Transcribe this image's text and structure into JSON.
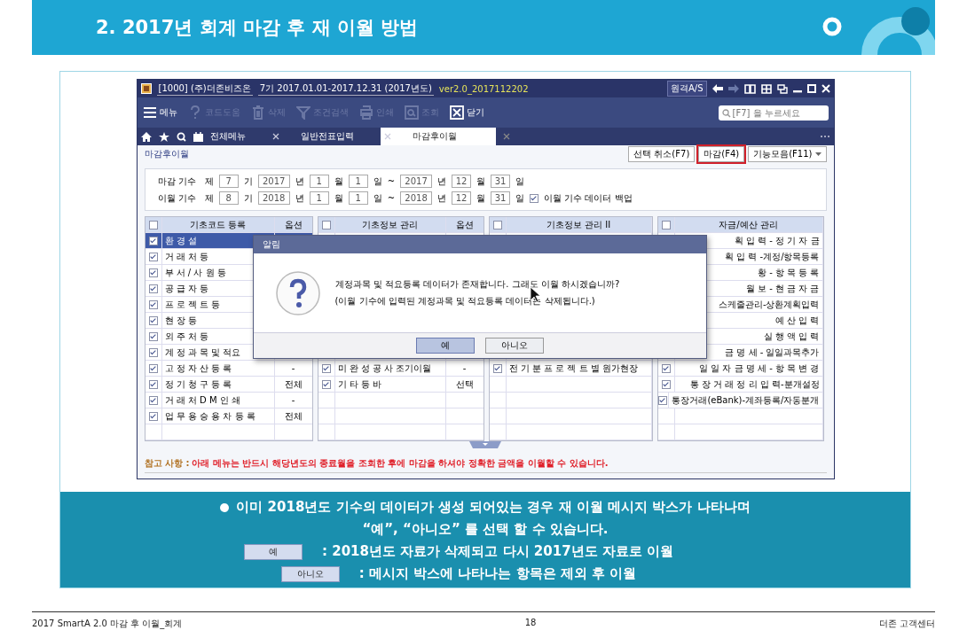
{
  "slide": {
    "title": "2. 2017년 회계 마감 후 재 이월 방법"
  },
  "app": {
    "title_segments": [
      "[1000] (주)더존비즈온",
      "7기 2017.01.01-2017.12.31 (2017년도)"
    ],
    "version": "ver2.0_2017112202",
    "remote_label": "원격A/S",
    "toolbar": [
      {
        "label": "메뉴",
        "disabled": false
      },
      {
        "label": "코드도움",
        "disabled": true
      },
      {
        "label": "삭제",
        "disabled": true
      },
      {
        "label": "조건검색",
        "disabled": true
      },
      {
        "label": "인쇄",
        "disabled": true
      },
      {
        "label": "조회",
        "disabled": true
      },
      {
        "label": "닫기",
        "disabled": false
      }
    ],
    "search": {
      "placeholder": "[F7] 을 누르세요"
    },
    "tabs": [
      {
        "label": "전체메뉴",
        "selected": false
      },
      {
        "label": "일반전표입력",
        "selected": false
      },
      {
        "label": "마감후이월",
        "selected": true
      }
    ],
    "page_title": "마감후이월",
    "actions": [
      {
        "label": "선택 취소(F7)",
        "highlighted": false
      },
      {
        "label": "마감(F4)",
        "highlighted": true
      },
      {
        "label": "기능모음(F11)",
        "highlighted": false
      }
    ],
    "periods": [
      {
        "label": "마감 기수",
        "parts": [
          {
            "kind": "text",
            "value": "제"
          },
          {
            "kind": "field",
            "value": "7"
          },
          {
            "kind": "text",
            "value": "기"
          },
          {
            "kind": "field",
            "value": "2017"
          },
          {
            "kind": "text",
            "value": "년"
          },
          {
            "kind": "field",
            "value": "1"
          },
          {
            "kind": "text",
            "value": "월"
          },
          {
            "kind": "field",
            "value": "1"
          },
          {
            "kind": "text",
            "value": "일"
          },
          {
            "kind": "text",
            "value": "~"
          },
          {
            "kind": "field",
            "value": "2017"
          },
          {
            "kind": "text",
            "value": "년"
          },
          {
            "kind": "field",
            "value": "12"
          },
          {
            "kind": "text",
            "value": "월"
          },
          {
            "kind": "field",
            "value": "31"
          },
          {
            "kind": "text",
            "value": "일"
          }
        ]
      },
      {
        "label": "이월 기수",
        "parts": [
          {
            "kind": "text",
            "value": "제"
          },
          {
            "kind": "field",
            "value": "8"
          },
          {
            "kind": "text",
            "value": "기"
          },
          {
            "kind": "field",
            "value": "2018"
          },
          {
            "kind": "text",
            "value": "년"
          },
          {
            "kind": "field",
            "value": "1"
          },
          {
            "kind": "text",
            "value": "월"
          },
          {
            "kind": "field",
            "value": "1"
          },
          {
            "kind": "text",
            "value": "일"
          },
          {
            "kind": "text",
            "value": "~"
          },
          {
            "kind": "field",
            "value": "2018"
          },
          {
            "kind": "text",
            "value": "년"
          },
          {
            "kind": "field",
            "value": "12"
          },
          {
            "kind": "text",
            "value": "월"
          },
          {
            "kind": "field",
            "value": "31"
          },
          {
            "kind": "text",
            "value": "일"
          }
        ],
        "backup": {
          "label": "이월 기수 데이터 백업",
          "checked": true
        }
      }
    ],
    "panels": [
      {
        "title": "기초코드 등록",
        "option_header": "옵션",
        "header_checked": false,
        "rows": [
          {
            "checked": true,
            "name": "환 경 설",
            "selected": true
          },
          {
            "checked": true,
            "name": "거 래 처 등",
            "selected": false
          },
          {
            "checked": true,
            "name": "부 서 / 사 원 등",
            "selected": false
          },
          {
            "checked": true,
            "name": "공 급 자 등",
            "selected": false
          },
          {
            "checked": true,
            "name": "프 로 젝 트 등",
            "selected": false
          },
          {
            "checked": true,
            "name": "현 장 등",
            "selected": false
          },
          {
            "checked": true,
            "name": "외 주 처 등",
            "selected": false
          },
          {
            "checked": true,
            "name": "계 정 과 목 및 적요",
            "selected": false
          },
          {
            "checked": true,
            "name": "고 정 자 산 등 록",
            "option": "-",
            "selected": false
          },
          {
            "checked": true,
            "name": "정 기 청 구 등 록",
            "option": "전체",
            "selected": false
          },
          {
            "checked": true,
            "name": "거 래 처 D M 인 쇄",
            "option": "-",
            "selected": false
          },
          {
            "checked": true,
            "name": "업 무 용 승 용 차 등 록",
            "option": "전체",
            "selected": false
          },
          {
            "selected": false
          }
        ]
      },
      {
        "title": "기초정보 관리",
        "option_header": "옵션",
        "header_checked": false,
        "rows": [
          {},
          {},
          {},
          {},
          {},
          {},
          {},
          {},
          {
            "checked": true,
            "name": "미 완 성 공 사 조기이월",
            "option": "-"
          },
          {
            "checked": true,
            "name": "기 타 등 바",
            "option": "선택"
          },
          {},
          {},
          {}
        ]
      },
      {
        "title": "기초정보 관리 II",
        "header_checked": false,
        "rows": [
          {},
          {},
          {},
          {},
          {},
          {},
          {},
          {},
          {
            "checked": true,
            "name": "전 기 분 프 로 젝 트 별 원가현장"
          },
          {},
          {},
          {},
          {}
        ]
      },
      {
        "title": "자금/예산 관리",
        "header_checked": false,
        "rows": [
          {
            "name": "획 입 력 - 정 기 자 금"
          },
          {
            "name": "획 입 력 -계정/항목등록"
          },
          {
            "name": "황 - 항 목 등 록"
          },
          {
            "name": "월 보 - 현 금 자 금"
          },
          {
            "name": "스케줄관리-상환계획입력"
          },
          {
            "name": "예 산 입 력"
          },
          {
            "name": "실 행 액 입 력"
          },
          {
            "name": "금 명 세 - 일일과목추가"
          },
          {
            "checked": true,
            "name": "일 일 자 금 명 세 - 항 목 변 경"
          },
          {
            "checked": true,
            "name": "통 장 거 래 정 리 입 력-분개설정"
          },
          {
            "checked": true,
            "name": "통장거래(eBank)-계좌등록/자동분개"
          },
          {},
          {}
        ]
      }
    ],
    "dialog": {
      "title": "알림",
      "lines": [
        "계정과목 및 적요등록 데이터가 존재합니다. 그래도 이월 하시겠습니까?",
        "(이월 기수에 입력된 계정과목 및 적요등록 데이터는 삭제됩니다.)"
      ],
      "buttons": [
        {
          "label": "예",
          "selected": true
        },
        {
          "label": "아니오",
          "selected": false
        }
      ]
    },
    "note": {
      "label": "참고 사항 :",
      "text": "아래 메뉴는 반드시 해당년도의 종료월을 조회한 후에 마감을 하셔야 정확한 금액을 이월할 수 있습니다."
    }
  },
  "info": {
    "lines": [
      "이미 2018년도 기수의 데이터가 생성 되어있는 경우 재 이월 메시지 박스가 나타나며",
      "“예”, “아니오” 를 선택 할 수 있습니다."
    ],
    "legend": [
      {
        "button": "예",
        "text": ": 2018년도 자료가 삭제되고 다시 2017년도 자료로 이월"
      },
      {
        "button": "아니오",
        "text": ": 메시지 박스에 나타나는 항목은 제외 후 이월"
      }
    ]
  },
  "footer": {
    "left": "2017 SmartA 2.0 마감 후 이월_회계",
    "page": "18",
    "right": "더존 고객센터"
  }
}
